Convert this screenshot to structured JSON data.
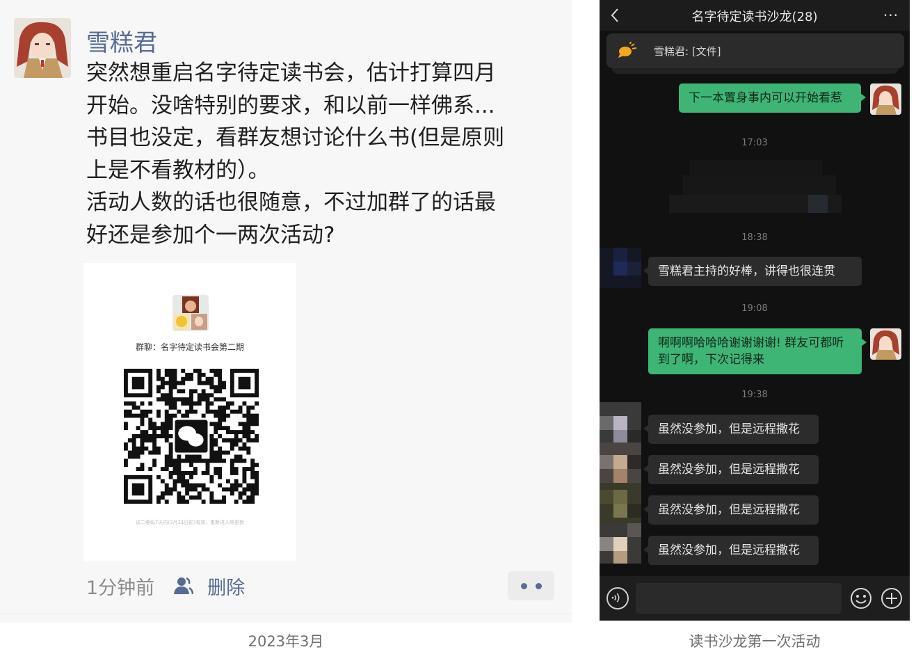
{
  "moments_post": {
    "author": "雪糕君",
    "text": "突然想重启名字待定读书会，估计打算四月\n开始。没啥特别的要求，和以前一样佛系...\n书目也没定，看群友想讨论什么书(但是原则\n上是不看教材的）。\n活动人数的话也很随意，不过加群了的话最\n好还是参加个一两次活动?",
    "qr_card": {
      "group_name": "群聊：名字待定读书会第二期",
      "note": "该二维码7天内(3月31日前)有效，重新进入将更新"
    },
    "time": "1分钟前",
    "delete_label": "删除",
    "more_icon": "more-dots-icon",
    "contacts_icon": "contacts-icon"
  },
  "caption_left": "2023年3月",
  "chat": {
    "title": "名字待定读书沙龙(28)",
    "back_icon": "back-chevron-icon",
    "more_icon": "more-icon",
    "pinned": "雪糕君: [文件]",
    "messages": [
      {
        "type": "out",
        "text": "下一本置身事内可以开始看惹"
      },
      {
        "type": "time",
        "text": "17:03"
      },
      {
        "type": "time",
        "text": "18:38"
      },
      {
        "type": "in",
        "text": "雪糕君主持的好棒，讲得也很连贯"
      },
      {
        "type": "time",
        "text": "19:08"
      },
      {
        "type": "out",
        "text": "啊啊啊哈哈哈谢谢谢谢! 群友可都听到了啊，下次记得来"
      },
      {
        "type": "time",
        "text": "19:38"
      },
      {
        "type": "in",
        "text": "虽然没参加，但是远程撒花"
      },
      {
        "type": "in",
        "text": "虽然没参加，但是远程撒花"
      },
      {
        "type": "in",
        "text": "虽然没参加，但是远程撒花"
      },
      {
        "type": "in",
        "text": "虽然没参加，但是远程撒花"
      }
    ],
    "colors": {
      "out_bubble": "#3eb575",
      "in_bubble": "#2c2c2c",
      "background": "#111111"
    }
  },
  "caption_right": "读书沙龙第一次活动"
}
